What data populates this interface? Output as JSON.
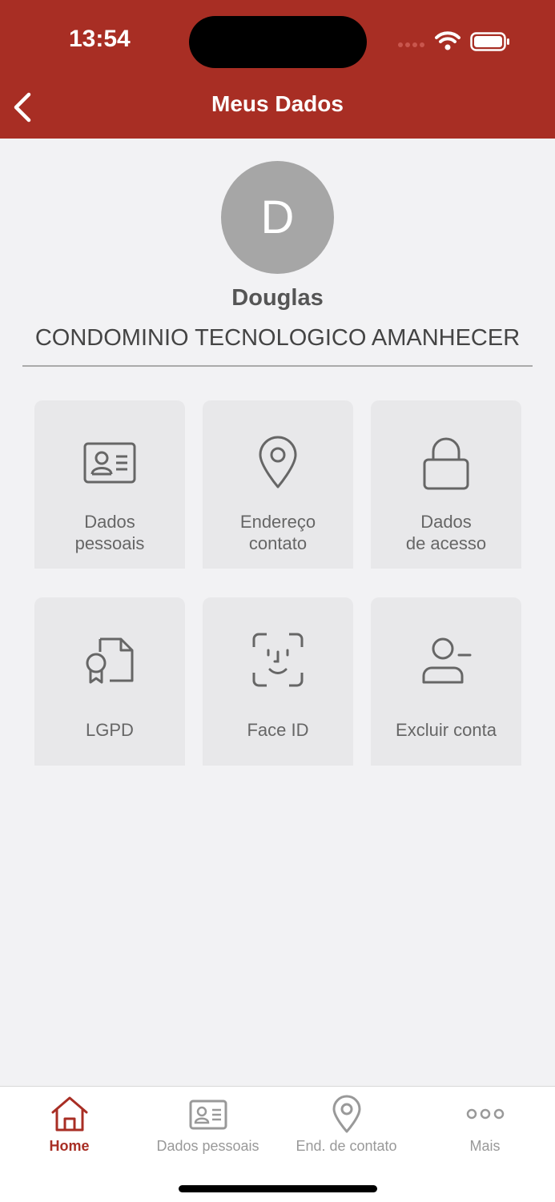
{
  "status_bar": {
    "time": "13:54"
  },
  "header": {
    "title": "Meus Dados"
  },
  "profile": {
    "initial": "D",
    "name": "Douglas",
    "condominium": "CONDOMINIO TECNOLOGICO AMANHECER"
  },
  "tiles": [
    {
      "label": "Dados\npessoais",
      "icon": "id-card-icon"
    },
    {
      "label": "Endereço\ncontato",
      "icon": "location-pin-icon"
    },
    {
      "label": "Dados\nde acesso",
      "icon": "lock-icon"
    },
    {
      "label": "LGPD",
      "icon": "certificate-document-icon"
    },
    {
      "label": "Face ID",
      "icon": "face-id-icon"
    },
    {
      "label": "Excluir conta",
      "icon": "user-remove-icon"
    }
  ],
  "tabbar": {
    "items": [
      {
        "label": "Home",
        "icon": "home-icon",
        "active": true
      },
      {
        "label": "Dados pessoais",
        "icon": "id-card-icon",
        "active": false
      },
      {
        "label": "End. de contato",
        "icon": "location-pin-icon",
        "active": false
      },
      {
        "label": "Mais",
        "icon": "more-icon",
        "active": false
      }
    ]
  },
  "colors": {
    "accent": "#a82e24",
    "background": "#f2f2f4",
    "tile": "#e8e8ea"
  }
}
